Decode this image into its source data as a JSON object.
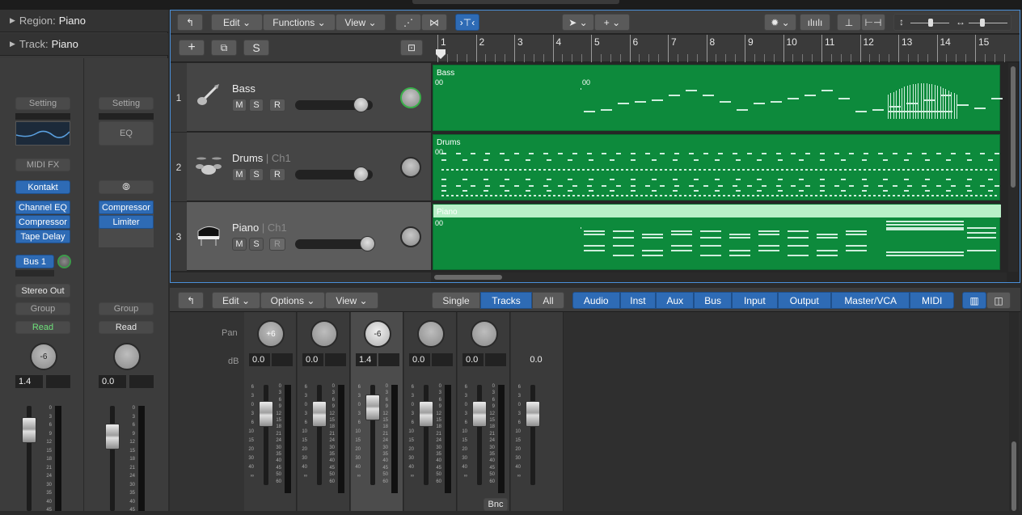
{
  "inspector": {
    "region_label": "Region:",
    "region_name": "Piano",
    "track_label": "Track:",
    "track_name": "Piano",
    "left_strip": {
      "setting": "Setting",
      "midi_fx": "MIDI FX",
      "instrument": "Kontakt",
      "plugins": [
        "Channel EQ",
        "Compressor",
        "Tape Delay"
      ],
      "send": "Bus 1",
      "output": "Stereo Out",
      "group": "Group",
      "automation": "Read",
      "pan_value": "-6",
      "db_value": "1.4"
    },
    "right_strip": {
      "setting": "Setting",
      "eq": "EQ",
      "plugins": [
        "Compressor",
        "Limiter"
      ],
      "group": "Group",
      "automation": "Read",
      "db_value": "0.0"
    },
    "scale": [
      "0",
      "3",
      "6",
      "9",
      "12",
      "15",
      "18",
      "21",
      "24",
      "30",
      "35",
      "40",
      "45",
      "50",
      "60"
    ]
  },
  "tracks_toolbar": {
    "edit": "Edit",
    "functions": "Functions",
    "view": "View",
    "add": "+",
    "solo": "S"
  },
  "ruler": [
    "1",
    "2",
    "3",
    "4",
    "5",
    "6",
    "7",
    "8",
    "9",
    "10",
    "11",
    "12",
    "13",
    "14",
    "15"
  ],
  "tracks": [
    {
      "num": "1",
      "name": "Bass",
      "channel": "",
      "mute": "M",
      "solo": "S",
      "record": "R",
      "region": "Bass",
      "marker": "00",
      "marker2": "00"
    },
    {
      "num": "2",
      "name": "Drums",
      "channel": "Ch1",
      "mute": "M",
      "solo": "S",
      "record": "R",
      "region": "Drums",
      "marker": "00"
    },
    {
      "num": "3",
      "name": "Piano",
      "channel": "Ch1",
      "mute": "M",
      "solo": "S",
      "record": "R",
      "region": "Piano",
      "marker": "00"
    }
  ],
  "mixer": {
    "edit": "Edit",
    "options": "Options",
    "view": "View",
    "modes": [
      "Single",
      "Tracks",
      "All"
    ],
    "filters": [
      "Audio",
      "Inst",
      "Aux",
      "Bus",
      "Input",
      "Output",
      "Master/VCA",
      "MIDI"
    ],
    "pan_label": "Pan",
    "db_label": "dB",
    "channels": [
      {
        "pan": "+6",
        "db": "0.0"
      },
      {
        "pan": "",
        "db": "0.0"
      },
      {
        "pan": "-6",
        "db": "1.4"
      },
      {
        "pan": "",
        "db": "0.0"
      },
      {
        "pan": "",
        "db": "0.0"
      },
      {
        "pan": "",
        "db": "0.0"
      }
    ],
    "bnc": "Bnc",
    "scale": [
      "6",
      "3",
      "0",
      "3",
      "6",
      "10",
      "15",
      "20",
      "30",
      "40",
      "∞"
    ]
  }
}
